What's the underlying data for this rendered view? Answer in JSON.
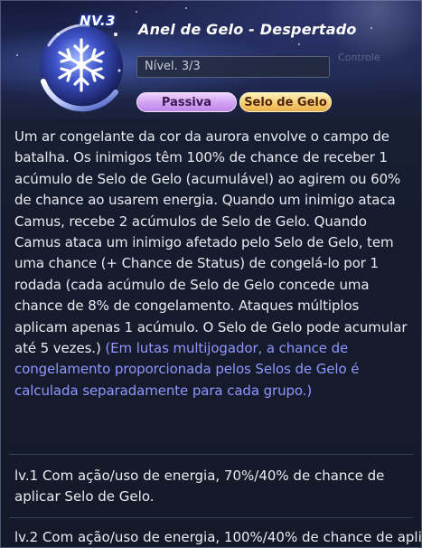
{
  "skill": {
    "level_badge": "NV.3",
    "title": "Anel de Gelo - Despertado",
    "level_field": "Nível. 3/3",
    "tags": [
      "Passiva",
      "Selo de Gelo"
    ],
    "icon": "snowflake-orb-icon"
  },
  "background_hint": "Controle",
  "description": "Um ar congelante da cor da aurora envolve o campo de batalha. Os inimigos têm 100% de chance de receber 1 acúmulo de Selo de Gelo (acumulável) ao agirem ou 60% de chance ao usarem energia. Quando um inimigo ataca Camus, recebe 2 acúmulos de Selo de Gelo. Quando Camus ataca um inimigo afetado pelo Selo de Gelo, tem uma chance (+ Chance de Status) de congelá-lo por 1 rodada (cada acúmulo de Selo de Gelo concede uma chance de 8% de congelamento. Ataques múltiplos aplicam apenas 1 acúmulo. O Selo de Gelo pode acumular até 5 vezes.)",
  "description_note": "(Em lutas multijogador, a chance de congelamento proporcionada pelos Selos de Gelo é calculada separadamente para cada grupo.)",
  "levels": [
    "lv.1 Com ação/uso de energia, 70%/40% de chance de aplicar Selo de Gelo.",
    "lv.2 Com ação/uso de energia, 100%/40% de chance de aplicar"
  ],
  "colors": {
    "note_text": "#8f96ff",
    "tag_passive": "#d2a4f3",
    "tag_ice": "#f7cd72",
    "panel_bg": "#161c2e"
  }
}
